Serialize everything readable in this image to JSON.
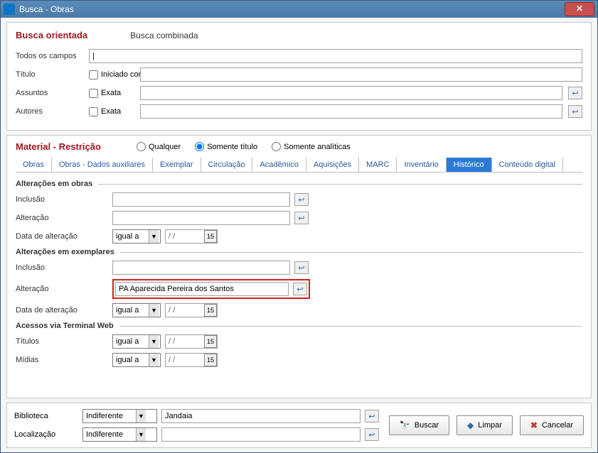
{
  "window": {
    "title": "Busca - Obras"
  },
  "search": {
    "heading": "Busca orientada",
    "combined": "Busca combinada",
    "todos_label": "Todos os campos",
    "titulo_label": "Título",
    "assuntos_label": "Assuntos",
    "autores_label": "Autores",
    "iniciado_com": "Iniciado com",
    "exata": "Exata",
    "todos_value": "|",
    "titulo_value": "",
    "assuntos_value": "",
    "autores_value": ""
  },
  "material": {
    "heading": "Material - Restrição",
    "qualquer": "Qualquer",
    "somente_titulo": "Somente título",
    "somente_analiticas": "Somente analíticas"
  },
  "tabs": {
    "obras": "Obras",
    "dados_aux": "Obras - Dados auxiliares",
    "exemplar": "Exemplar",
    "circulacao": "Circulação",
    "academico": "Acadêmico",
    "aquisicoes": "Aquisições",
    "marc": "MARC",
    "inventario": "Inventário",
    "historico": "Histórico",
    "conteudo": "Conteúdo digital"
  },
  "groups": {
    "alt_obras": "Alterações em obras",
    "alt_exemplares": "Alterações em exemplares",
    "acessos_web": "Acessos via Terminal Web"
  },
  "fields": {
    "inclusao": "Inclusão",
    "alteracao": "Alteração",
    "data_alteracao": "Data de alteração",
    "titulos": "Títulos",
    "midias": "Mídias",
    "igual_a": "igual a",
    "date_placeholder": "/  /",
    "alteracao_ex_value": "PA Aparecida Pereira dos Santos",
    "inclusao_obras_value": "",
    "alteracao_obras_value": "",
    "inclusao_ex_value": ""
  },
  "bottom": {
    "biblioteca_label": "Biblioteca",
    "localizacao_label": "Localização",
    "indiferente": "Indiferente",
    "biblioteca_value": "Jandaia",
    "localizacao_value": ""
  },
  "buttons": {
    "buscar": "Buscar",
    "limpar": "Limpar",
    "cancelar": "Cancelar"
  }
}
